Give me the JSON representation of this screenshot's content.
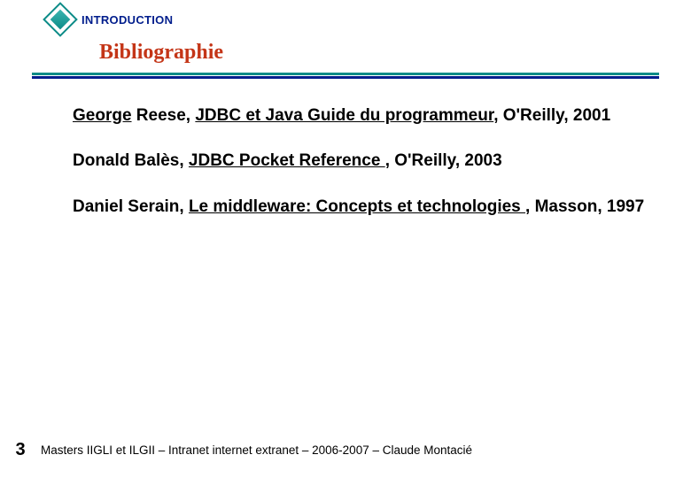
{
  "header": {
    "section_label": "INTRODUCTION",
    "slide_title": "Bibliographie"
  },
  "entries": [
    {
      "author_u": "George",
      "author_rest": " Reese, ",
      "title_u": "JDBC et Java Guide du programmeur",
      "trail": ", O'Reilly, 2001"
    },
    {
      "author_plain": "Donald Balès, ",
      "title_u": "JDBC Pocket Reference ",
      "trail": ", O'Reilly, 2003"
    },
    {
      "author_plain": "Daniel Serain, ",
      "title_u": "Le middleware: Concepts et technologies ",
      "trail": ", Masson, 1997"
    }
  ],
  "footer": {
    "page_number": "3",
    "text": "Masters IIGLI et ILGII – Intranet internet extranet – 2006-2007 – Claude Montacié"
  }
}
